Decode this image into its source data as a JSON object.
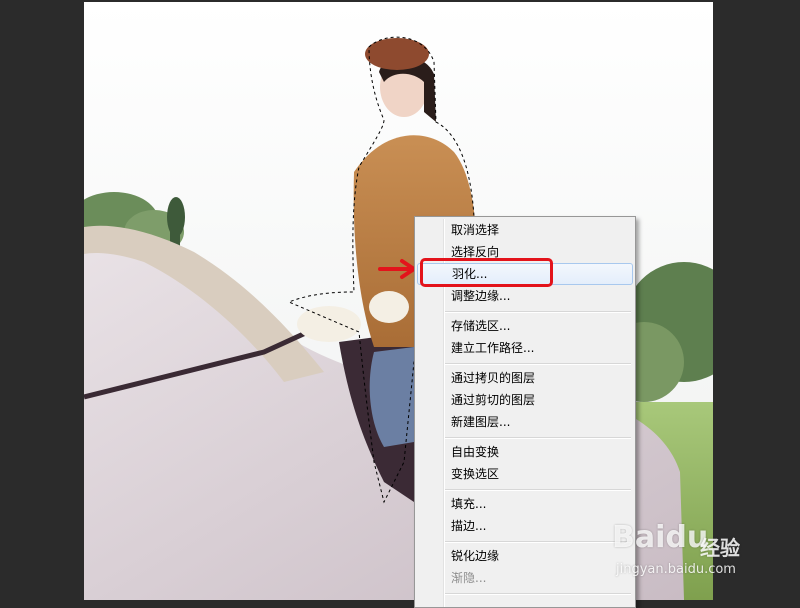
{
  "context_menu": {
    "items": [
      {
        "label": "取消选择"
      },
      {
        "label": "选择反向"
      },
      {
        "label": "羽化..."
      },
      {
        "label": "调整边缘..."
      },
      {
        "label": "存储选区..."
      },
      {
        "label": "建立工作路径..."
      },
      {
        "label": "通过拷贝的图层"
      },
      {
        "label": "通过剪切的图层"
      },
      {
        "label": "新建图层..."
      },
      {
        "label": "自由变换"
      },
      {
        "label": "变换选区"
      },
      {
        "label": "填充..."
      },
      {
        "label": "描边..."
      },
      {
        "label": "锐化边缘"
      },
      {
        "label": "渐隐..."
      }
    ],
    "highlighted_item": "羽化...",
    "disabled_item": "渐隐..."
  },
  "annotation": {
    "arrow_color": "#e3131b",
    "box_color": "#e3131b"
  },
  "watermark": {
    "logo": "Baidu",
    "text": "经验",
    "url": "jingyan.baidu.com"
  },
  "colors": {
    "workspace": "#2b2b2b",
    "menu_bg": "#f0f0f0",
    "menu_border": "#979797"
  }
}
